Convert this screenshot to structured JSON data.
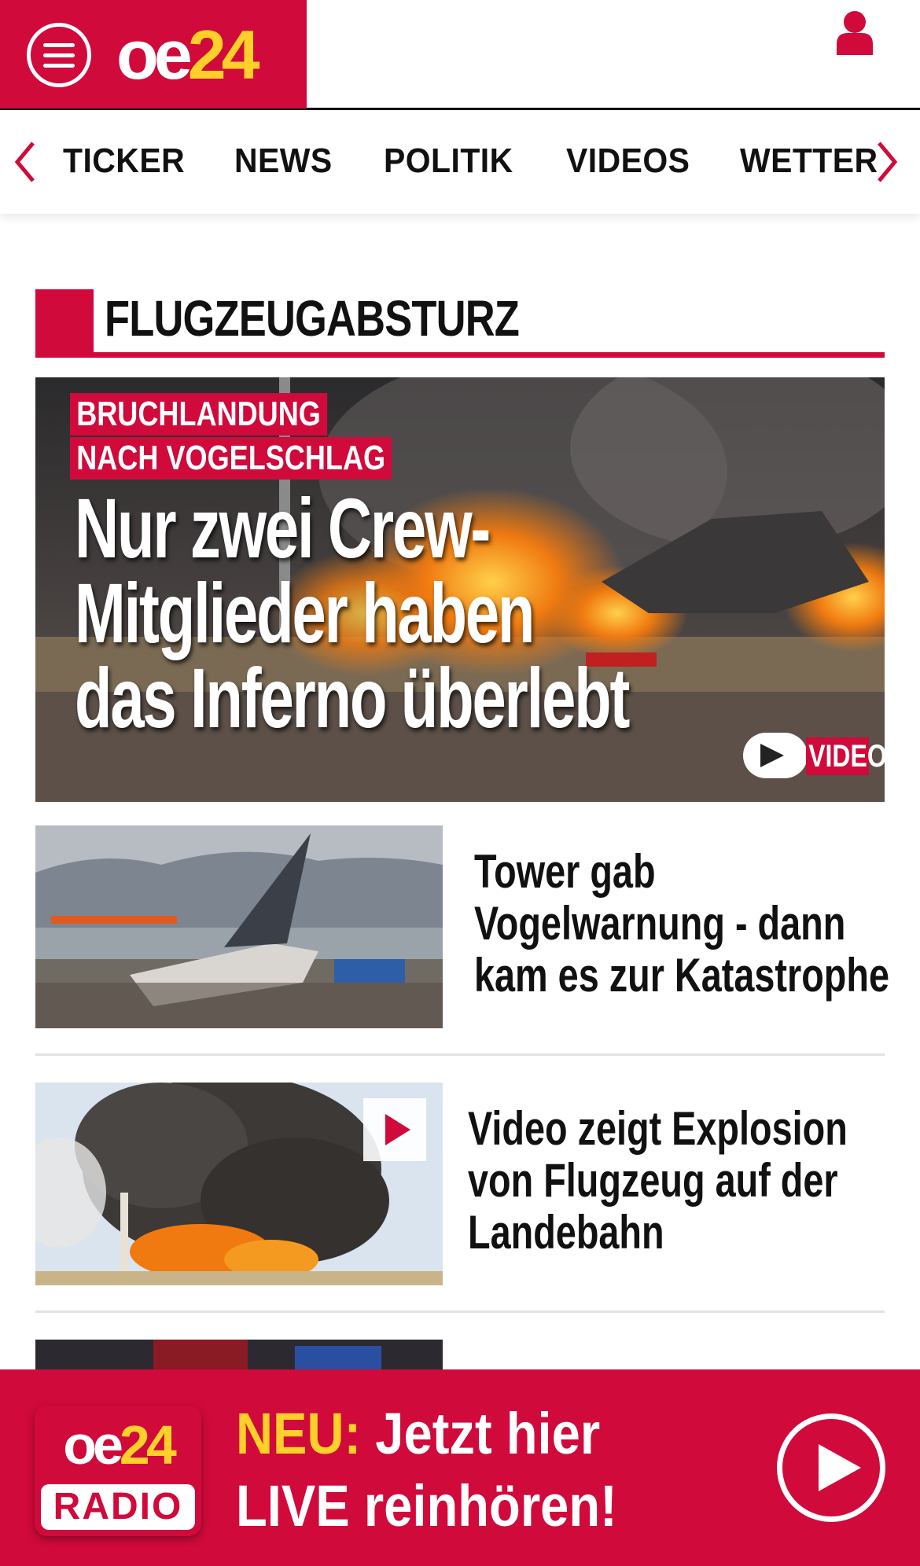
{
  "header": {
    "logo_oe": "oe",
    "logo_num": "24",
    "brand_color": "#d00a3b",
    "accent_color": "#ffd02a",
    "menu_icon": "hamburger-menu-icon",
    "user_icon": "user-icon"
  },
  "nav": {
    "items": [
      "TICKER",
      "NEWS",
      "POLITIK",
      "VIDEOS",
      "WETTER"
    ],
    "left_icon": "chevron-left-icon",
    "right_icon": "chevron-right-icon"
  },
  "section": {
    "title": "FLUGZEUGABSTURZ"
  },
  "hero": {
    "kicker_line1": "BRUCHLANDUNG",
    "kicker_line2": "NACH VOGELSCHLAG",
    "title_line1": "Nur zwei Crew-",
    "title_line2": "Mitglieder haben",
    "title_line3": "das Inferno überlebt",
    "video_label": "VIDEO"
  },
  "articles": [
    {
      "line1": "Tower gab",
      "line2": "Vogelwarnung - dann",
      "line3": "kam es zur Katastrophe"
    },
    {
      "line1": "Video zeigt Explosion",
      "line2": "von Flugzeug auf der",
      "line3": "Landebahn"
    }
  ],
  "radio": {
    "logo_oe": "oe",
    "logo_num": "24",
    "logo_sub": "RADIO",
    "neu": "NEU:",
    "line1_rest": " Jetzt hier",
    "line2": "LIVE reinhören!"
  }
}
